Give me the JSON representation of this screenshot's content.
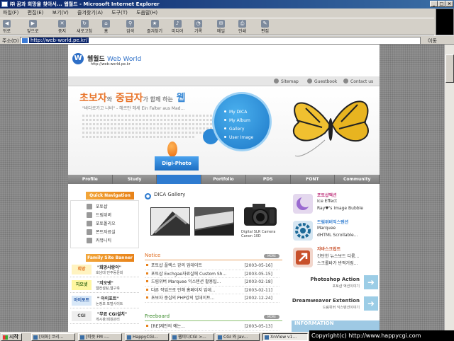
{
  "window": {
    "title": "㈜ 꿈과 희망을 찾아서... 웹월드 - Microsoft Internet Explorer",
    "min": "_",
    "max": "□",
    "close": "×"
  },
  "menu": [
    "파일(F)",
    "편집(E)",
    "보기(V)",
    "즐겨찾기(A)",
    "도구(T)",
    "도움말(H)"
  ],
  "toolbar": [
    {
      "label": "뒤로",
      "icon": "back-icon",
      "glyph": "◀"
    },
    {
      "label": "앞으로",
      "icon": "forward-icon",
      "glyph": "▶"
    },
    {
      "label": "중지",
      "icon": "stop-icon",
      "glyph": "✕"
    },
    {
      "label": "새로고침",
      "icon": "refresh-icon",
      "glyph": "↻"
    },
    {
      "label": "홈",
      "icon": "home-icon",
      "glyph": "⌂"
    },
    {
      "label": "검색",
      "icon": "search-icon",
      "glyph": "⚲"
    },
    {
      "label": "즐겨찾기",
      "icon": "favorites-icon",
      "glyph": "★"
    },
    {
      "label": "미디어",
      "icon": "media-icon",
      "glyph": "♪"
    },
    {
      "label": "기록",
      "icon": "history-icon",
      "glyph": "◔"
    },
    {
      "label": "메일",
      "icon": "mail-icon",
      "glyph": "✉"
    },
    {
      "label": "인쇄",
      "icon": "print-icon",
      "glyph": "⎙"
    },
    {
      "label": "편집",
      "icon": "edit-icon",
      "glyph": "✎"
    }
  ],
  "address": {
    "label": "주소(D)",
    "url": "http://web-world.pe.kr/",
    "go": "이동"
  },
  "site": {
    "logo_letter": "W",
    "name_ko": "웹월드",
    "name_en": "Web World",
    "url": "http://web-world.pe.kr",
    "util_links": [
      "Sitemap",
      "Guestbook",
      "Contact us"
    ],
    "hero": {
      "title_a": "초보자",
      "title_b": "와",
      "title_c": "중급자",
      "title_d": "가 함께 하는",
      "title_e": "웹",
      "subtitle": "\"바다로가고 나비\" - 헤르만 헤세 Ein Falter aus Mad...",
      "menu": [
        "My DICA",
        "My Album",
        "Gallery",
        "User Image"
      ],
      "digi_photo": "Digi-Photo"
    },
    "nav": [
      "Profile",
      "Study",
      "",
      "Portfolio",
      "PDS",
      "FONT",
      "Community"
    ],
    "quick_nav": {
      "title": "Quick Navigation",
      "items": [
        "포토샵",
        "드림위버",
        "포토폴리오",
        "폰트자료실",
        "커뮤니티"
      ]
    },
    "family": {
      "title": "Family Site Banner",
      "items": [
        {
          "banner": "희망",
          "name": "\"희망사랑이\"",
          "desc": "호남대 민주동문회"
        },
        {
          "banner": "지오넷",
          "name": "\"지오넷\"",
          "desc": "웹컨설팅,웹구축"
        },
        {
          "banner": "아이포트",
          "name": "\" 아이포트\"",
          "desc": "논정보 포털사이트"
        },
        {
          "banner": "CGI",
          "name": "\"무료 CGI설치\"",
          "desc": "게시판/회원관리"
        }
      ]
    },
    "dica": {
      "title": "DICA Gallery",
      "camera_label": [
        "Digital SLR Camera",
        "Canon 10D"
      ]
    },
    "notice": {
      "title": "Notice",
      "more": "MORE",
      "items": [
        {
          "text": "포토샵 플렉스 강의 업데이트",
          "date": "[2003-05-16]"
        },
        {
          "text": "포토샵 Exchgae자료실에 Custom Sh...",
          "date": "[2003-05-15]"
        },
        {
          "text": "드림위버 Marquee 익스텐션 활용팁...",
          "date": "[2003-02-18]"
        },
        {
          "text": "다른 작업으로 인해 홈페이지 업데...",
          "date": "[2003-02-11]"
        },
        {
          "text": "초보자 중심의 PHP강의 업데이트...",
          "date": "[2002-12-24]"
        }
      ]
    },
    "freeboard": {
      "title": "Freeboard",
      "more": "MORE",
      "items": [
        {
          "text": "[RE]제안의 예는...",
          "date": "[2003-05-13]"
        }
      ]
    },
    "right": [
      {
        "title": "포토샵액션",
        "title_color": "#c03a80",
        "icon": "moon-icon",
        "icon_bg": "#d9cde8",
        "lines": [
          "Ice Effect",
          "Ray♥'s Image Bubble"
        ]
      },
      {
        "title": "드림위버익스텐션",
        "title_color": "#2e7bd0",
        "icon": "gear-icon",
        "icon_bg": "#cfe0ee",
        "lines": [
          "Marquee",
          "dHTML Scrollable..."
        ]
      },
      {
        "title": "자바스크립트",
        "title_color": "#c8502a",
        "icon": "arrow-icon",
        "icon_bg": "#f0d2c8",
        "lines": [
          "간단한 뉴스보드 디룸...",
          "스크롤바가 반짝거림..."
        ]
      }
    ],
    "promos": [
      {
        "title": "Photoshop Action",
        "sub": "포토샵 액션이야기"
      },
      {
        "title": "Dreamweaver Extention",
        "sub": "드림위버 익스텐션이야기"
      }
    ],
    "info": "INFORMATION"
  },
  "taskbar": {
    "start": "시작",
    "tasks": [
      "[대화] 코리...",
      "[따뜻 FM -...",
      "HappyCGI...",
      "웹피디CGI >...",
      "CGI 와 Jav...",
      "XnView v1..."
    ],
    "active_index": 5
  },
  "copyright": "Copyright(c) http://www.happycgi.com"
}
